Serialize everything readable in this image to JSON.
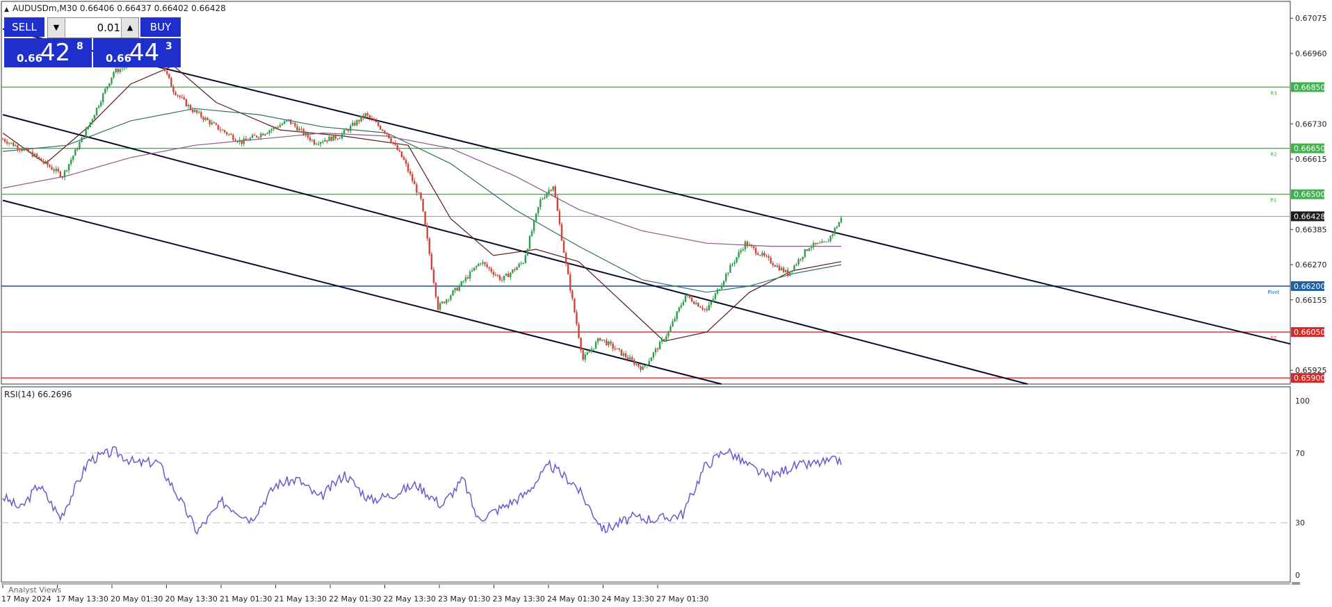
{
  "chart_header": {
    "symbol_text": "AUDUSDm,M30  0.66406 0.66437 0.66402 0.66428",
    "rsi_text": "RSI(14) 66.2696",
    "footer_text": "Analyst Views"
  },
  "trade_panel": {
    "sell_label": "SELL",
    "buy_label": "BUY",
    "volume": "0.01",
    "sell_prefix": "0.66",
    "sell_big": "42",
    "sell_sup": "8",
    "buy_prefix": "0.66",
    "buy_big": "44",
    "buy_sup": "3"
  },
  "colors": {
    "bull": "#2e9e4a",
    "bear": "#d0443a",
    "resistance": "#3cb44b",
    "pivot": "#1f5fa8",
    "support": "#d42a2a",
    "channel": "#0a0a2a",
    "rsi": "#6a5acd",
    "ma_fast": "#5b1a1a",
    "ma_mid": "#2f6f5f",
    "ma_slow": "#8a5a8a",
    "button_blue": "#1e2fcc"
  },
  "chart_data": [
    {
      "type": "candlestick",
      "title": "AUDUSDm,M30",
      "x_tick_labels": [
        "17 May 2024",
        "17 May 13:30",
        "20 May 01:30",
        "20 May 13:30",
        "21 May 01:30",
        "21 May 13:30",
        "22 May 01:30",
        "22 May 13:30",
        "23 May 01:30",
        "23 May 13:30",
        "24 May 01:30",
        "24 May 13:30",
        "27 May 01:30"
      ],
      "y_tick_labels": [
        "0.67075",
        "0.66960",
        "0.66730",
        "0.66615",
        "0.66385",
        "0.66270",
        "0.66155",
        "0.65925"
      ],
      "ylim": [
        0.6588,
        0.6713
      ],
      "current_price": "0.66428",
      "levels": [
        {
          "name": "R3",
          "value": 0.6685,
          "label": "0.66850",
          "kind": "resistance"
        },
        {
          "name": "R2",
          "value": 0.6665,
          "label": "0.66650",
          "kind": "resistance"
        },
        {
          "name": "R1",
          "value": 0.665,
          "label": "0.66500",
          "kind": "resistance"
        },
        {
          "name": "Pivot",
          "value": 0.662,
          "label": "0.66200",
          "kind": "pivot"
        },
        {
          "name": "S2",
          "value": 0.6605,
          "label": "0.66050",
          "kind": "support"
        },
        {
          "name": "",
          "value": 0.659,
          "label": "0.65900",
          "kind": "support"
        }
      ],
      "anchors": [
        [
          0,
          0.6668
        ],
        [
          14,
          0.6663
        ],
        [
          28,
          0.6656
        ],
        [
          40,
          0.6672
        ],
        [
          52,
          0.669
        ],
        [
          62,
          0.6693
        ],
        [
          72,
          0.6697
        ],
        [
          80,
          0.6684
        ],
        [
          88,
          0.6678
        ],
        [
          100,
          0.6672
        ],
        [
          112,
          0.6667
        ],
        [
          122,
          0.667
        ],
        [
          134,
          0.6674
        ],
        [
          146,
          0.6667
        ],
        [
          158,
          0.6669
        ],
        [
          170,
          0.6676
        ],
        [
          180,
          0.667
        ],
        [
          188,
          0.6661
        ],
        [
          196,
          0.6648
        ],
        [
          204,
          0.6613
        ],
        [
          214,
          0.662
        ],
        [
          224,
          0.6628
        ],
        [
          234,
          0.6622
        ],
        [
          244,
          0.6628
        ],
        [
          252,
          0.6648
        ],
        [
          258,
          0.6653
        ],
        [
          264,
          0.6627
        ],
        [
          272,
          0.6596
        ],
        [
          280,
          0.6603
        ],
        [
          290,
          0.6598
        ],
        [
          300,
          0.6593
        ],
        [
          312,
          0.6605
        ],
        [
          320,
          0.6617
        ],
        [
          330,
          0.6612
        ],
        [
          340,
          0.6625
        ],
        [
          348,
          0.6634
        ],
        [
          358,
          0.6629
        ],
        [
          368,
          0.6624
        ],
        [
          378,
          0.6633
        ],
        [
          386,
          0.6634
        ],
        [
          393,
          0.6642
        ]
      ],
      "moving_averages": [
        {
          "name": "",
          "color_key": "ma_fast",
          "points": [
            [
              0,
              0.667
            ],
            [
              20,
              0.666
            ],
            [
              40,
              0.6672
            ],
            [
              60,
              0.6686
            ],
            [
              80,
              0.6692
            ],
            [
              100,
              0.668
            ],
            [
              130,
              0.6671
            ],
            [
              160,
              0.6669
            ],
            [
              190,
              0.6666
            ],
            [
              210,
              0.6642
            ],
            [
              230,
              0.663
            ],
            [
              250,
              0.6632
            ],
            [
              270,
              0.6628
            ],
            [
              290,
              0.6615
            ],
            [
              310,
              0.6602
            ],
            [
              330,
              0.6605
            ],
            [
              350,
              0.6618
            ],
            [
              370,
              0.6625
            ],
            [
              393,
              0.6628
            ]
          ]
        },
        {
          "name": "",
          "color_key": "ma_mid",
          "points": [
            [
              0,
              0.6664
            ],
            [
              30,
              0.6666
            ],
            [
              60,
              0.6674
            ],
            [
              90,
              0.6678
            ],
            [
              120,
              0.6676
            ],
            [
              150,
              0.6672
            ],
            [
              180,
              0.667
            ],
            [
              210,
              0.666
            ],
            [
              240,
              0.6645
            ],
            [
              270,
              0.6633
            ],
            [
              300,
              0.6622
            ],
            [
              330,
              0.6618
            ],
            [
              350,
              0.662
            ],
            [
              370,
              0.6624
            ],
            [
              393,
              0.6627
            ]
          ]
        },
        {
          "name": "",
          "color_key": "ma_slow",
          "points": [
            [
              0,
              0.6652
            ],
            [
              30,
              0.6656
            ],
            [
              60,
              0.6662
            ],
            [
              90,
              0.6666
            ],
            [
              120,
              0.6668
            ],
            [
              150,
              0.667
            ],
            [
              180,
              0.6669
            ],
            [
              210,
              0.6665
            ],
            [
              240,
              0.6656
            ],
            [
              270,
              0.6645
            ],
            [
              300,
              0.6638
            ],
            [
              330,
              0.6634
            ],
            [
              360,
              0.6633
            ],
            [
              393,
              0.6633
            ]
          ]
        }
      ],
      "channel_lines": [
        [
          [
            0,
            0.6704
          ],
          [
            393,
            0.6637
          ]
        ],
        [
          [
            0,
            0.6676
          ],
          [
            393,
            0.6604
          ]
        ],
        [
          [
            0,
            0.6648
          ],
          [
            393,
            0.6578
          ]
        ]
      ]
    },
    {
      "type": "line",
      "title": "RSI(14) 66.2696",
      "y_tick_labels": [
        "100",
        "70",
        "30",
        "0"
      ],
      "ylim": [
        0,
        100
      ],
      "levels": [
        70,
        30
      ],
      "series": [
        {
          "name": "RSI(14)",
          "anchors": [
            [
              0,
              45
            ],
            [
              10,
              38
            ],
            [
              20,
              52
            ],
            [
              32,
              33
            ],
            [
              48,
              66
            ],
            [
              62,
              71
            ],
            [
              74,
              64
            ],
            [
              86,
              65
            ],
            [
              96,
              48
            ],
            [
              108,
              25
            ],
            [
              122,
              42
            ],
            [
              138,
              32
            ],
            [
              152,
              52
            ],
            [
              164,
              55
            ],
            [
              176,
              44
            ],
            [
              190,
              58
            ],
            [
              204,
              43
            ],
            [
              216,
              46
            ],
            [
              230,
              52
            ],
            [
              244,
              40
            ],
            [
              256,
              55
            ],
            [
              264,
              32
            ],
            [
              276,
              38
            ],
            [
              290,
              46
            ],
            [
              304,
              63
            ],
            [
              318,
              52
            ],
            [
              334,
              26
            ],
            [
              350,
              33
            ],
            [
              364,
              32
            ],
            [
              378,
              35
            ],
            [
              390,
              62
            ],
            [
              402,
              72
            ],
            [
              414,
              63
            ],
            [
              426,
              56
            ],
            [
              438,
              62
            ],
            [
              452,
              64
            ],
            [
              466,
              66
            ]
          ]
        }
      ]
    }
  ]
}
